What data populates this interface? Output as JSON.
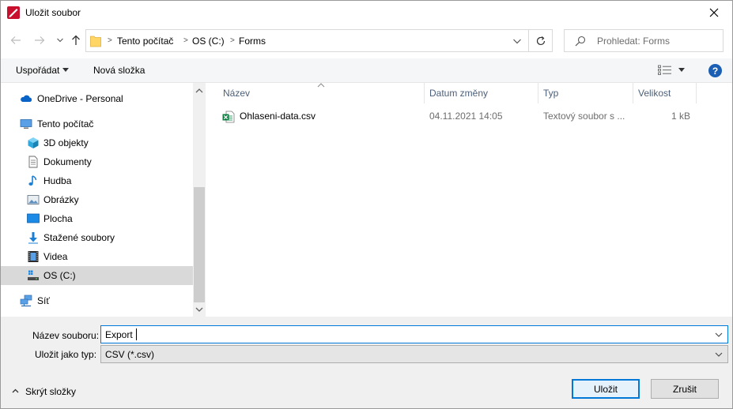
{
  "window": {
    "title": "Uložit soubor"
  },
  "address": {
    "crumbs": [
      "Tento počítač",
      "OS (C:)",
      "Forms"
    ]
  },
  "search": {
    "placeholder": "Prohledat: Forms"
  },
  "toolbar": {
    "organize_label": "Uspořádat",
    "new_folder_label": "Nová složka",
    "help_label": "?"
  },
  "sidebar": {
    "items": [
      {
        "label": "OneDrive - Personal",
        "icon": "cloud-icon"
      },
      {
        "label": "Tento počítač",
        "icon": "computer-icon"
      },
      {
        "label": "3D objekty",
        "icon": "cube-icon"
      },
      {
        "label": "Dokumenty",
        "icon": "document-icon"
      },
      {
        "label": "Hudba",
        "icon": "music-icon"
      },
      {
        "label": "Obrázky",
        "icon": "picture-icon"
      },
      {
        "label": "Plocha",
        "icon": "desktop-icon"
      },
      {
        "label": "Stažené soubory",
        "icon": "download-icon"
      },
      {
        "label": "Videa",
        "icon": "video-icon"
      },
      {
        "label": "OS (C:)",
        "icon": "drive-icon",
        "selected": true
      },
      {
        "label": "Síť",
        "icon": "network-icon"
      }
    ]
  },
  "filelist": {
    "columns": [
      "Název",
      "Datum změny",
      "Typ",
      "Velikost"
    ],
    "rows": [
      {
        "name": "Ohlaseni-data.csv",
        "date": "04.11.2021 14:05",
        "type": "Textový soubor s ...",
        "size": "1 kB",
        "icon": "excel-csv-icon"
      }
    ]
  },
  "form": {
    "filename_label": "Název souboru:",
    "filename_value": "Export",
    "filetype_label": "Uložit jako typ:",
    "filetype_value": "CSV (*.csv)"
  },
  "footer": {
    "hide_folders_label": "Skrýt složky",
    "save_label": "Uložit",
    "cancel_label": "Zrušit"
  },
  "colors": {
    "accent": "#0078d7",
    "selected_bg": "#d9d9d9"
  }
}
